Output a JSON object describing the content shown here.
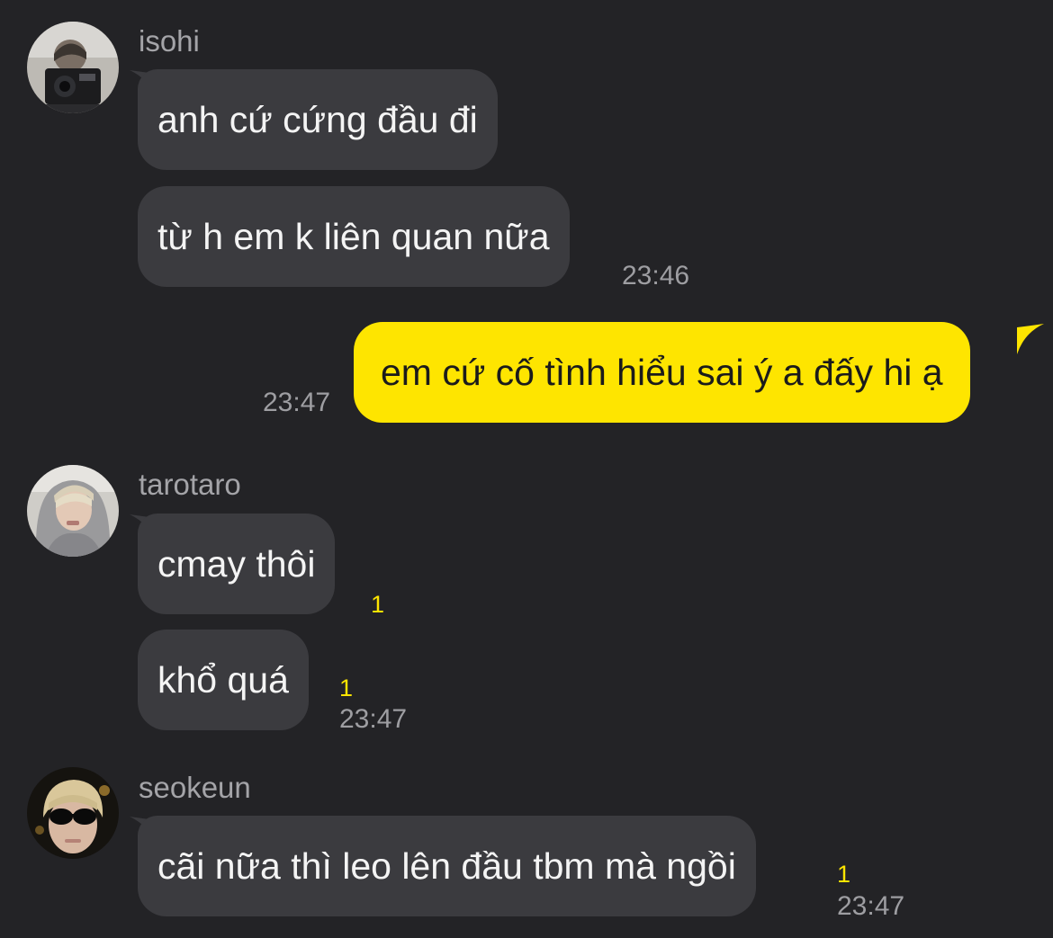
{
  "colors": {
    "background": "#232326",
    "bubble_received": "#3b3b3f",
    "bubble_sent": "#fee500",
    "unread_count": "#fee500",
    "name_text": "#a4a4a8",
    "time_text": "#9e9ea2"
  },
  "groups": [
    {
      "sender": "isohi",
      "avatar_icon": "profile-photo-camera",
      "messages": [
        {
          "text": "anh cứ cứng đầu đi"
        },
        {
          "text": "từ h em k liên quan nữa",
          "time": "23:46"
        }
      ]
    },
    {
      "sender": "me",
      "messages": [
        {
          "text": "em cứ cố tình hiểu sai ý a đấy hi ạ",
          "time": "23:47"
        }
      ]
    },
    {
      "sender": "tarotaro",
      "avatar_icon": "profile-photo-hoodie",
      "messages": [
        {
          "text": "cmay thôi",
          "unread": "1"
        },
        {
          "text": "khổ quá",
          "unread": "1",
          "time": "23:47"
        }
      ]
    },
    {
      "sender": "seokeun",
      "avatar_icon": "profile-photo-sunglasses",
      "messages": [
        {
          "text": "cãi nữa thì leo lên đầu tbm mà ngồi",
          "unread": "1",
          "time": "23:47"
        }
      ]
    }
  ]
}
